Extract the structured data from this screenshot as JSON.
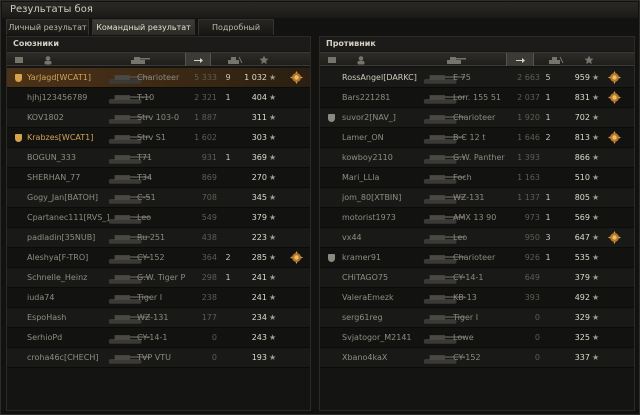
{
  "window": {
    "title": "Результаты боя"
  },
  "tabs": [
    "Личный результат",
    "Командный результат",
    "Подробный отчёт"
  ],
  "allies": {
    "title": "Союзники",
    "rows": [
      {
        "player": "YarJagd[WCAT1]",
        "tank": "Charioteer",
        "dmg": "5 333",
        "kills": "9",
        "xp": "1 032",
        "badge": true,
        "clan": "gold",
        "highlight": true
      },
      {
        "player": "hjhj123456789",
        "tank": "T-10",
        "dmg": "2 321",
        "kills": "1",
        "xp": "404"
      },
      {
        "player": "KOV1802",
        "tank": "Strv 103-0",
        "dmg": "1 887",
        "kills": "",
        "xp": "311"
      },
      {
        "player": "Krabzes[WCAT1]",
        "tank": "Strv S1",
        "dmg": "1 602",
        "kills": "",
        "xp": "303",
        "clan": "gold"
      },
      {
        "player": "BOGUN_333",
        "tank": "T71",
        "dmg": "931",
        "kills": "1",
        "xp": "369"
      },
      {
        "player": "SHERHAN_77",
        "tank": "T34",
        "dmg": "869",
        "kills": "",
        "xp": "270"
      },
      {
        "player": "Gogy_Jan[BATOH]",
        "tank": "C-51",
        "dmg": "708",
        "kills": "",
        "xp": "345"
      },
      {
        "player": "Cpartanec111[RVS_]",
        "tank": "Leo",
        "dmg": "549",
        "kills": "",
        "xp": "379"
      },
      {
        "player": "padladin[35NUB]",
        "tank": "Ru 251",
        "dmg": "438",
        "kills": "",
        "xp": "223"
      },
      {
        "player": "Aleshya[F-TRO]",
        "tank": "CY-152",
        "dmg": "364",
        "kills": "2",
        "xp": "285",
        "badge": true
      },
      {
        "player": "Schnelle_Heinz",
        "tank": "G.W. Tiger P",
        "dmg": "298",
        "kills": "1",
        "xp": "241"
      },
      {
        "player": "iuda74",
        "tank": "Tiger I",
        "dmg": "238",
        "kills": "",
        "xp": "241"
      },
      {
        "player": "EspoHash",
        "tank": "WZ-131",
        "dmg": "177",
        "kills": "",
        "xp": "234"
      },
      {
        "player": "SerhioPd",
        "tank": "CY-14-1",
        "dmg": "0",
        "kills": "",
        "xp": "243"
      },
      {
        "player": "croha46c[CHECH]",
        "tank": "TVP VTU",
        "dmg": "0",
        "kills": "",
        "xp": "193"
      }
    ]
  },
  "enemies": {
    "title": "Противник",
    "rows": [
      {
        "player": "RossAngel[DARKC]",
        "tank": "E 75",
        "dmg": "2 663",
        "kills": "5",
        "xp": "959",
        "badge": true,
        "hl": true
      },
      {
        "player": "Bars221281",
        "tank": "Lorr. 155 51",
        "dmg": "2 037",
        "kills": "1",
        "xp": "831",
        "badge": true
      },
      {
        "player": "suvor2[NAV_]",
        "tank": "Charioteer",
        "dmg": "1 920",
        "kills": "1",
        "xp": "702",
        "clan": "gray"
      },
      {
        "player": "Lamer_ON",
        "tank": "B-C 12 t",
        "dmg": "1 646",
        "kills": "2",
        "xp": "813",
        "badge": true
      },
      {
        "player": "kowboy2110",
        "tank": "G.W. Panther",
        "dmg": "1 393",
        "kills": "",
        "xp": "866"
      },
      {
        "player": "Mari_LLla",
        "tank": "Foch",
        "dmg": "1 163",
        "kills": "",
        "xp": "510"
      },
      {
        "player": "jom_80[XTBIN]",
        "tank": "WZ-131",
        "dmg": "1 137",
        "kills": "1",
        "xp": "805"
      },
      {
        "player": "motorist1973",
        "tank": "AMX 13 90",
        "dmg": "973",
        "kills": "1",
        "xp": "569"
      },
      {
        "player": "vx44",
        "tank": "Leo",
        "dmg": "950",
        "kills": "3",
        "xp": "647",
        "badge": true
      },
      {
        "player": "kramer91",
        "tank": "Charioteer",
        "dmg": "926",
        "kills": "1",
        "xp": "535",
        "clan": "gray"
      },
      {
        "player": "CHiTAGO75",
        "tank": "CY-14-1",
        "dmg": "649",
        "kills": "",
        "xp": "379"
      },
      {
        "player": "ValeraEmezk",
        "tank": "KB-13",
        "dmg": "393",
        "kills": "",
        "xp": "492"
      },
      {
        "player": "serg61reg",
        "tank": "Tiger I",
        "dmg": "0",
        "kills": "",
        "xp": "329"
      },
      {
        "player": "Svjatogor_M2141",
        "tank": "Lowe",
        "dmg": "0",
        "kills": "",
        "xp": "325"
      },
      {
        "player": "Xbano4kaX",
        "tank": "CY-152",
        "dmg": "0",
        "kills": "",
        "xp": "337"
      }
    ]
  },
  "icons": [
    "platoon-icon",
    "player-icon",
    "tank-icon",
    "damage-icon",
    "kills-icon",
    "xp-star-icon"
  ]
}
